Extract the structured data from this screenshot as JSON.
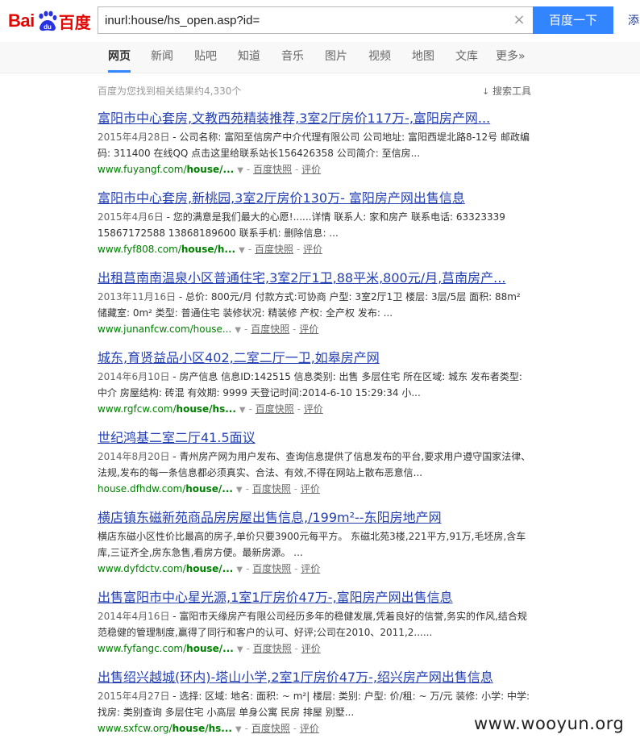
{
  "header": {
    "logo_text_left": "Bai",
    "logo_text_du": "du",
    "logo_text_right": "百度",
    "search_value": "inurl:house/hs_open.asp?id=",
    "search_button": "百度一下",
    "extra_link": "添"
  },
  "nav": {
    "tabs": [
      "网页",
      "新闻",
      "贴吧",
      "知道",
      "音乐",
      "图片",
      "视频",
      "地图",
      "文库",
      "更多»"
    ],
    "active": "网页"
  },
  "results_count": "百度为您找到相关结果约4,330个",
  "search_tools": "搜索工具",
  "snapshot_label": "百度快照",
  "evaluate_label": "评价",
  "url_arrow": "▼",
  "url_sep": "-",
  "results": [
    {
      "title": "富阳市中心套房,文教西苑精装推荐,3室2厅房价117万-,富阳房产网...",
      "date": "2015年4月28日",
      "snippet": " - 公司名称: 富阳至信房产中介代理有限公司 公司地址: 富阳西堤北路8-12号 邮政编码: 311400 在线QQ 点击这里给联系站长156426358 公司简介: 至信房...",
      "url_pre": "www.fuyangf.com/",
      "url_bold": "house/...",
      "url_post": ""
    },
    {
      "title": "富阳市中心套房,新桃园,3室2厅房价130万- 富阳房产网出售信息",
      "date": "2015年4月6日",
      "snippet": " - 您的满意是我们最大的心愿!......详情 联系人: 家和房产 联系电话: 63323339 15867172588 13868189600 联系手机: 删除信息: ...",
      "url_pre": "www.fyf808.com/",
      "url_bold": "house/h...",
      "url_post": ""
    },
    {
      "title": "出租莒南南温泉小区普通住宅,3室2厅1卫,88平米,800元/月,莒南房产...",
      "date": "2013年11月16日",
      "snippet": " - 总价: 800元/月 付款方式:可协商 户型: 3室2厅1卫 楼层: 3层/5层 面积: 88m² 储藏室: 0m² 类型: 普通住宅 装修状况: 精装修 产权: 全产权 发布: ...",
      "url_pre": "www.junanfcw.com/house...",
      "url_bold": "",
      "url_post": ""
    },
    {
      "title": "城东,育贤益品小区402,二室二厅一卫,如皋房产网",
      "date": "2014年6月10日",
      "snippet": " - 房产信息 信息ID:142515 信息类别: 出售 多层住宅 所在区域: 城东 发布者类型: 中介 房屋结构: 砖混 有效期: 9999 天登记时间:2014-6-10 15:29:34 小...",
      "url_pre": "www.rgfcw.com/",
      "url_bold": "house/hs...",
      "url_post": ""
    },
    {
      "title": "世纪鸿基二室二厅41.5面议",
      "date": "2014年8月20日",
      "snippet": " - 青州房产网为用户发布、查询信息提供了信息发布的平台,要求用户遵守国家法律、法规,发布的每一条信息都必须真实、合法、有效,不得在网站上散布恶意信...",
      "url_pre": "house.dfhdw.com/",
      "url_bold": "house/...",
      "url_post": ""
    },
    {
      "title": "横店镇东磁新苑商品房房屋出售信息,/199m²--东阳房地产网",
      "date": "",
      "snippet": "横店东磁小区性价比最高的房子,单价只要3900元每平方。 东磁北苑3楼,221平方,91万,毛坯房,含车库,三证齐全,房东急售,看房方便。最新房源。 ...",
      "url_pre": "www.dyfdctv.com/",
      "url_bold": "house/...",
      "url_post": ""
    },
    {
      "title": "出售富阳市中心星光源,1室1厅房价47万-,富阳房产网出售信息",
      "date": "2014年4月16日",
      "snippet": " - 富阳市天缘房产有限公司经历多年的稳健发展,凭着良好的信誉,务实的作风,结合规范稳健的管理制度,赢得了同行和客户的认可、好评;公司在2010、2011,2......",
      "url_pre": "www.fyfangc.com/",
      "url_bold": "house/...",
      "url_post": ""
    },
    {
      "title": "出售绍兴越城(环内)-塔山小学,2室1厅房价47万-,绍兴房产网出售信息",
      "date": "2015年4月27日",
      "snippet": " - 选择: 区域: 地名: 面积: ~ m²| 楼层: 类别: 户型: 价/租: ~ 万/元 装修: 小学: 中学: 找房: 类别查询 多层住宅 小高层 单身公寓 民房 排屋 别墅...",
      "url_pre": "www.sxfcw.org/",
      "url_bold": "house/hs...",
      "url_post": ""
    }
  ],
  "watermark": "www.wooyun.org",
  "colors": {
    "accent": "#3385ff",
    "title_link": "#2440b3",
    "url_green": "#008000",
    "logo_red": "#e10602"
  }
}
